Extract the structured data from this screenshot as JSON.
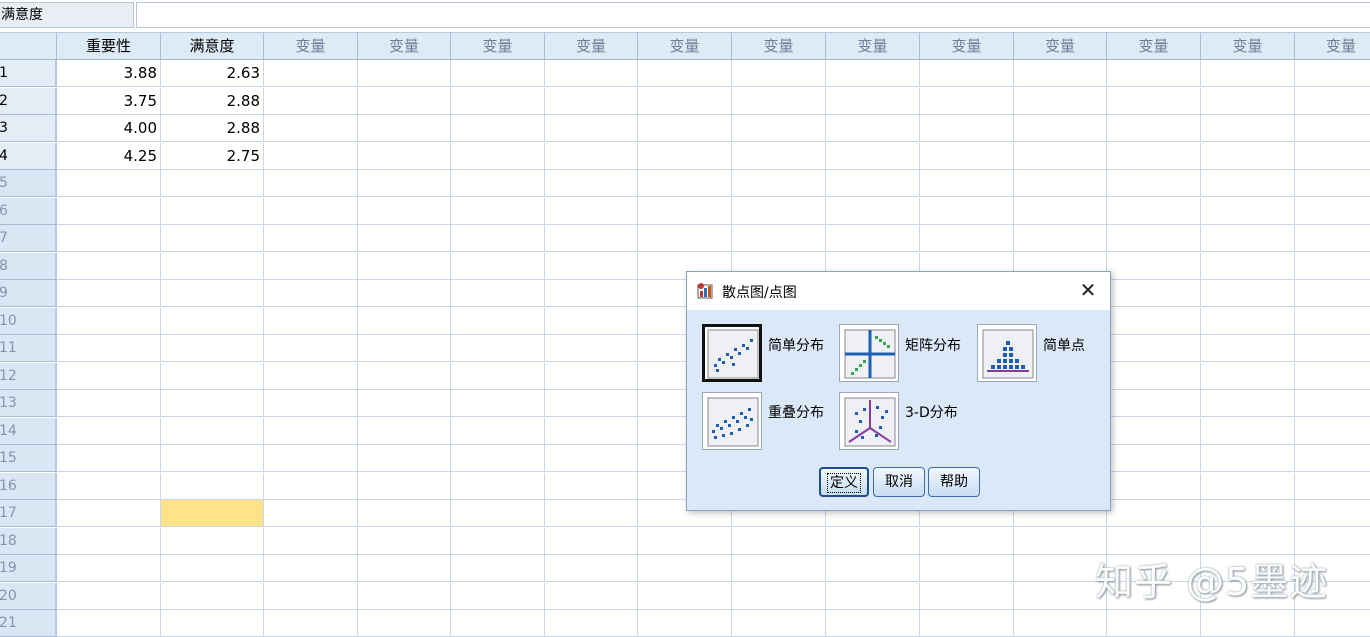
{
  "cellref": {
    "name": "满意度",
    "value": ""
  },
  "columns": {
    "var1": "重要性",
    "var2": "满意度",
    "empty_label": "变量"
  },
  "rows": [
    {
      "n": "1",
      "a": "3.88",
      "b": "2.63"
    },
    {
      "n": "2",
      "a": "3.75",
      "b": "2.88"
    },
    {
      "n": "3",
      "a": "4.00",
      "b": "2.88"
    },
    {
      "n": "4",
      "a": "4.25",
      "b": "2.75"
    },
    {
      "n": "5"
    },
    {
      "n": "6"
    },
    {
      "n": "7"
    },
    {
      "n": "8"
    },
    {
      "n": "9"
    },
    {
      "n": "10"
    },
    {
      "n": "11"
    },
    {
      "n": "12"
    },
    {
      "n": "13"
    },
    {
      "n": "14"
    },
    {
      "n": "15"
    },
    {
      "n": "16"
    },
    {
      "n": "17"
    },
    {
      "n": "18"
    },
    {
      "n": "19"
    },
    {
      "n": "20"
    },
    {
      "n": "21"
    }
  ],
  "selected_cell": {
    "row": "17",
    "column": "满意度"
  },
  "dialog": {
    "title": "散点图/点图",
    "icon": "chart-builder-icon",
    "options": [
      {
        "label": "简单分布",
        "icon": "simple-scatter-icon",
        "selected": true
      },
      {
        "label": "矩阵分布",
        "icon": "matrix-scatter-icon",
        "selected": false
      },
      {
        "label": "简单点",
        "icon": "simple-dot-icon",
        "selected": false
      },
      {
        "label": "重叠分布",
        "icon": "overlay-scatter-icon",
        "selected": false
      },
      {
        "label": "3-D分布",
        "icon": "3d-scatter-icon",
        "selected": false
      }
    ],
    "buttons": {
      "define": "定义",
      "cancel": "取消",
      "help": "帮助"
    }
  },
  "watermark": "知乎 @5墨迹",
  "colors": {
    "selected_cell": "#ffe28a",
    "header_bg": "#dfeaf7",
    "dialog_bg": "#dbe8f7"
  }
}
